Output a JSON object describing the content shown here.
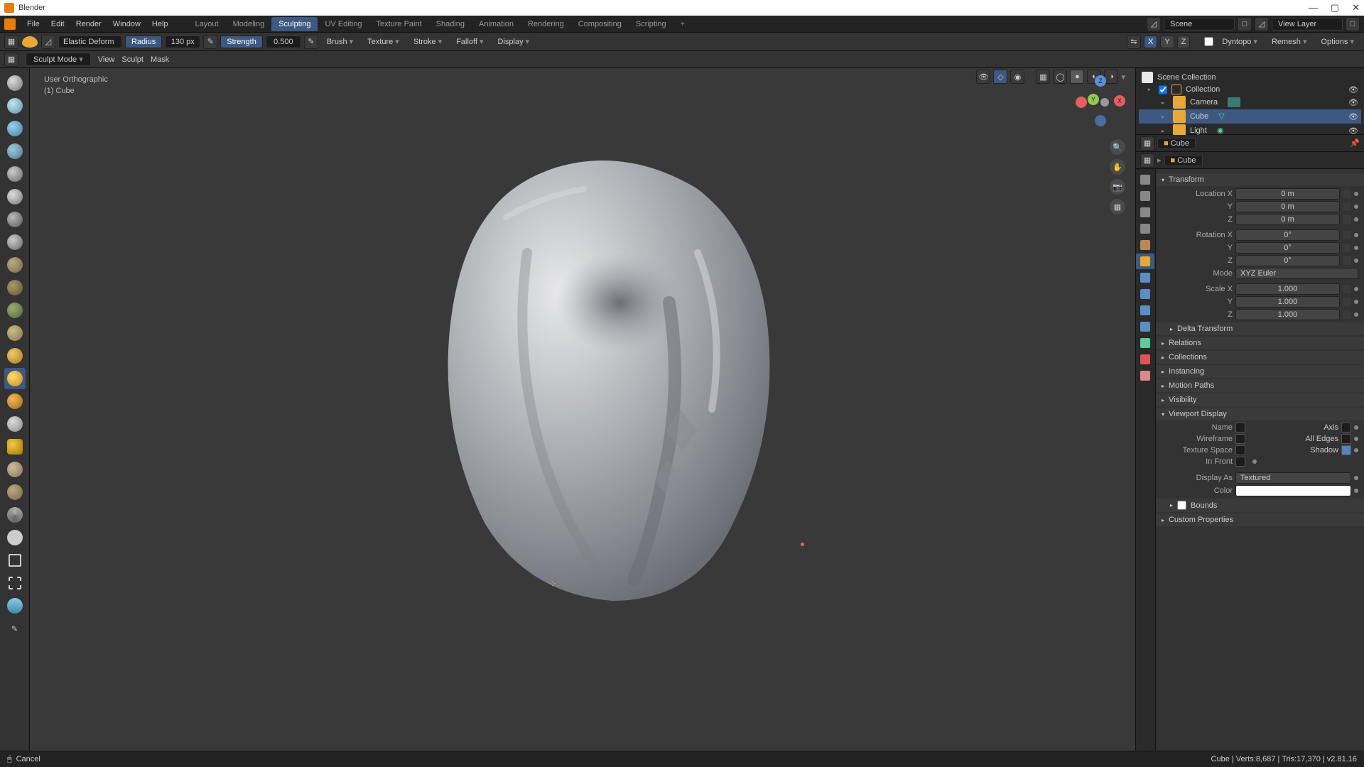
{
  "app": {
    "title": "Blender"
  },
  "menus": [
    "File",
    "Edit",
    "Render",
    "Window",
    "Help"
  ],
  "workspace_tabs": [
    "Layout",
    "Modeling",
    "Sculpting",
    "UV Editing",
    "Texture Paint",
    "Shading",
    "Animation",
    "Rendering",
    "Compositing",
    "Scripting"
  ],
  "workspace_active": 2,
  "top_right": {
    "scene": "Scene",
    "viewlayer": "View Layer"
  },
  "toolbar": {
    "brush_name": "Elastic Deform",
    "radius_label": "Radius",
    "radius_value": "130 px",
    "strength_label": "Strength",
    "strength_value": "0.500",
    "brush_drop": "Brush",
    "texture_drop": "Texture",
    "stroke_drop": "Stroke",
    "falloff_drop": "Falloff",
    "display_drop": "Display",
    "sym_x": "X",
    "sym_y": "Y",
    "sym_z": "Z",
    "dyntopo": "Dyntopo",
    "remesh": "Remesh",
    "options": "Options"
  },
  "secondbar": {
    "mode": "Sculpt Mode",
    "menus": [
      "View",
      "Sculpt",
      "Mask"
    ]
  },
  "viewport": {
    "orient": "User Orthographic",
    "obj": "(1) Cube"
  },
  "outliner": {
    "root": "Scene Collection",
    "col": "Collection",
    "items": [
      {
        "name": "Camera",
        "icon": "#67b8a5"
      },
      {
        "name": "Cube",
        "icon": "#e8a838"
      },
      {
        "name": "Light",
        "icon": "#e8a838"
      }
    ]
  },
  "breadcrumb": {
    "obj": "Cube",
    "data": "Cube"
  },
  "transform": {
    "header": "Transform",
    "loc": {
      "label": "Location X",
      "x": "0 m",
      "y": "0 m",
      "z": "0 m"
    },
    "rot": {
      "label": "Rotation X",
      "x": "0°",
      "y": "0°",
      "z": "0°"
    },
    "mode_label": "Mode",
    "mode_val": "XYZ Euler",
    "scale": {
      "label": "Scale X",
      "x": "1.000",
      "y": "1.000",
      "z": "1.000"
    }
  },
  "panels": [
    "Delta Transform",
    "Relations",
    "Collections",
    "Instancing",
    "Motion Paths",
    "Visibility"
  ],
  "viewport_display": {
    "header": "Viewport Display",
    "name": "Name",
    "axis": "Axis",
    "wireframe": "Wireframe",
    "all_edges": "All Edges",
    "texspace": "Texture Space",
    "shadow": "Shadow",
    "infront": "In Front",
    "displayas_label": "Display As",
    "displayas_val": "Textured",
    "color_label": "Color"
  },
  "bounds": "Bounds",
  "custom_props": "Custom Properties",
  "status": {
    "cancel": "Cancel",
    "info": "Cube | Verts:8,687 | Tris:17,370 | v2.81.16"
  }
}
